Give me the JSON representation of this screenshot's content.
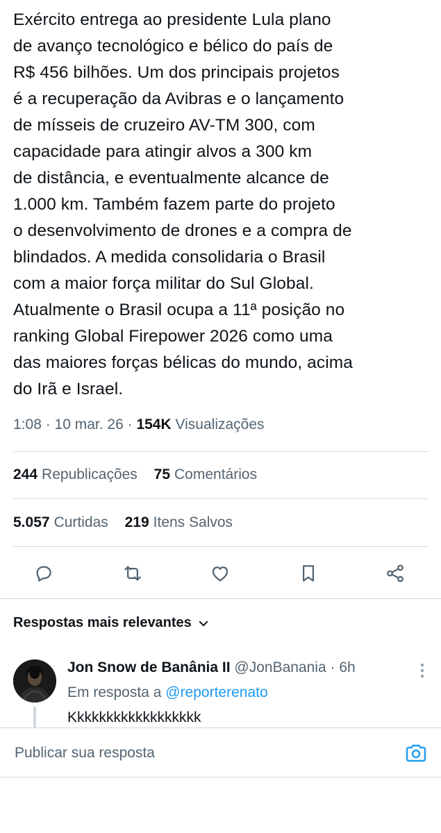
{
  "tweet": {
    "text": "Exército entrega ao presidente Lula plano\nde avanço tecnológico e bélico do país de\nR$ 456 bilhões. Um dos principais projetos\né a recuperação da Avibras e o lançamento\nde mísseis de cruzeiro AV-TM 300, com\ncapacidade para atingir alvos a 300 km\nde distância, e eventualmente alcance de\n1.000 km. Também fazem parte do projeto\no desenvolvimento de drones e a compra de\nblindados. A medida consolidaria o Brasil\ncom a maior força militar do Sul Global.\nAtualmente  o Brasil ocupa a 11ª posição no\nranking Global Firepower 2026 como uma\ndas maiores forças bélicas do mundo, acima\ndo Irã e Israel.",
    "time": "1:08",
    "date": "10 mar. 26",
    "views_count": "154K",
    "views_label": "Visualizações"
  },
  "stats": {
    "reposts_count": "244",
    "reposts_label": "Republicações",
    "comments_count": "75",
    "comments_label": "Comentários",
    "likes_count": "5.057",
    "likes_label": "Curtidas",
    "bookmarks_count": "219",
    "bookmarks_label": "Itens Salvos"
  },
  "actions": [
    "reply-icon",
    "repost-icon",
    "like-icon",
    "bookmark-icon",
    "share-icon"
  ],
  "replies": {
    "sort_label": "Respostas mais relevantes",
    "item": {
      "name": "Jon Snow de Banânia II",
      "handle": "@JonBanania",
      "time": "6h",
      "in_reply_prefix": "Em resposta a",
      "in_reply_handle": "@reporterenato",
      "text": "Kkkkkkkkkkkkkkkkkk"
    }
  },
  "composer": {
    "placeholder": "Publicar sua resposta"
  },
  "colors": {
    "text": "#0f1419",
    "secondary": "#536471",
    "accent": "#1d9bf0",
    "border": "#cfd9de"
  }
}
